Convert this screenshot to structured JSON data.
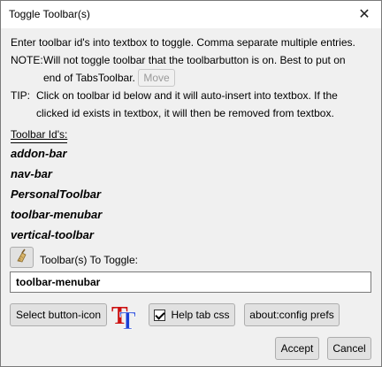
{
  "window": {
    "title": "Toggle Toolbar(s)",
    "close_glyph": "✕"
  },
  "instructions": {
    "line1": "Enter toolbar id's into textbox to toggle. Comma separate multiple entries.",
    "note_label": "NOTE:",
    "note_line1": "Will not toggle toolbar that the toolbarbutton is on. Best to put on",
    "note_line2": "end of TabsToolbar.",
    "move_button": "Move",
    "tip_label": "TIP:",
    "tip_line1": "Click on toolbar id below and it will auto-insert into textbox. If the",
    "tip_line2": "clicked id exists in textbox, it will then be removed from textbox."
  },
  "toolbar_ids": {
    "heading": "Toolbar Id's:",
    "items": [
      "addon-bar",
      "nav-bar",
      "PersonalToolbar",
      "toolbar-menubar",
      "vertical-toolbar"
    ]
  },
  "toggle": {
    "broom_icon": "broom-icon",
    "label": "Toolbar(s) To Toggle:",
    "value": "toolbar-menubar"
  },
  "actions": {
    "select_icon_button": "Select button-icon",
    "tt_icon": "TT",
    "help_tab_css": "Help tab css",
    "help_tab_css_checked": true,
    "about_config": "about:config prefs",
    "accept": "Accept",
    "cancel": "Cancel"
  },
  "colors": {
    "tt_red": "#cc1111",
    "tt_blue": "#1a3fd6"
  }
}
